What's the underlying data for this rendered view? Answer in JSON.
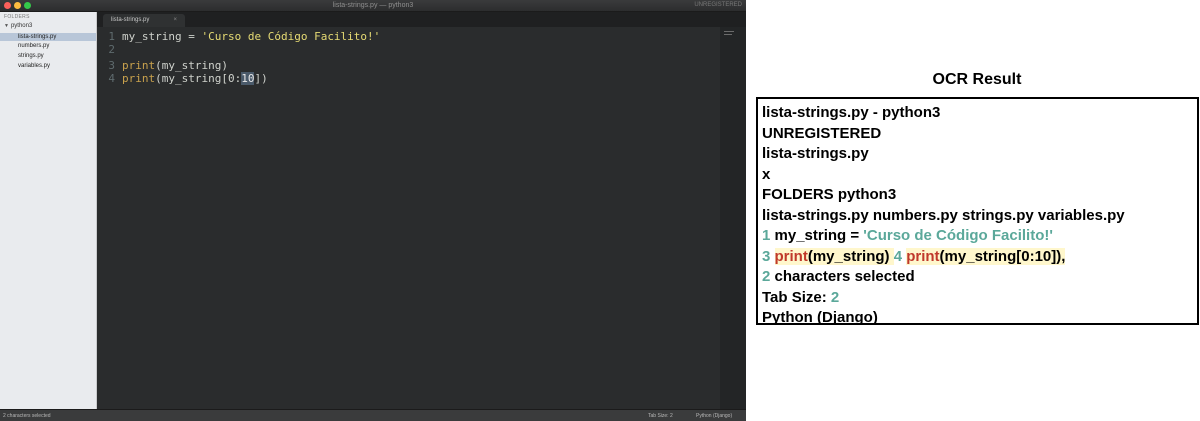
{
  "window": {
    "title": "lista-strings.py — python3",
    "unregistered": "UNREGISTERED",
    "traffic_lights": [
      "close",
      "minimize",
      "zoom"
    ]
  },
  "sidebar": {
    "header": "FOLDERS",
    "folder": "python3",
    "files": [
      {
        "name": "lista-strings.py",
        "active": true
      },
      {
        "name": "numbers.py",
        "active": false
      },
      {
        "name": "strings.py",
        "active": false
      },
      {
        "name": "variables.py",
        "active": false
      }
    ]
  },
  "tab": {
    "label": "lista-strings.py",
    "close": "×"
  },
  "code": {
    "lines": [
      {
        "n": "1",
        "var": "my_string",
        "op": " = ",
        "str": "'Curso de Código Facilito!'"
      },
      {
        "n": "2"
      },
      {
        "n": "3",
        "fn": "print",
        "rest": "(my_string)"
      },
      {
        "n": "4",
        "fn": "print",
        "rest_a": "(my_string[0:",
        "selected": "10",
        "rest_b": "])"
      }
    ]
  },
  "statusbar": {
    "left": "2 characters selected",
    "tab_size": "Tab Size: 2",
    "syntax": "Python (Django)"
  },
  "ocr": {
    "title": "OCR Result",
    "l1": "lista-strings.py - python3",
    "l2": "UNREGISTERED",
    "l3": "lista-strings.py",
    "l4": "x",
    "l5": "FOLDERS python3",
    "l6": "lista-strings.py numbers.py strings.py variables.py",
    "l7_num": "1",
    "l7_text": " my_string = ",
    "l7_str": "'Curso de Código Facilito!'",
    "l8_num3": "3",
    "l8_kw1": "print",
    "l8_mid": "(my_string) ",
    "l8_num4": "4",
    "l8_kw2": "print",
    "l8_end": "(my_string[0:10]),",
    "l9_num": "2",
    "l9_text": " characters selected",
    "l10_text": "Tab Size: ",
    "l10_num": "2",
    "l11": "Python (Django)"
  },
  "colors": {
    "editor_bg": "#2a2c2d",
    "sidebar_bg": "#e9ebee",
    "string": "#e6db74",
    "keyword": "#c9a24d",
    "ocr_num": "#5ba89a",
    "ocr_kw": "#c0392b"
  }
}
